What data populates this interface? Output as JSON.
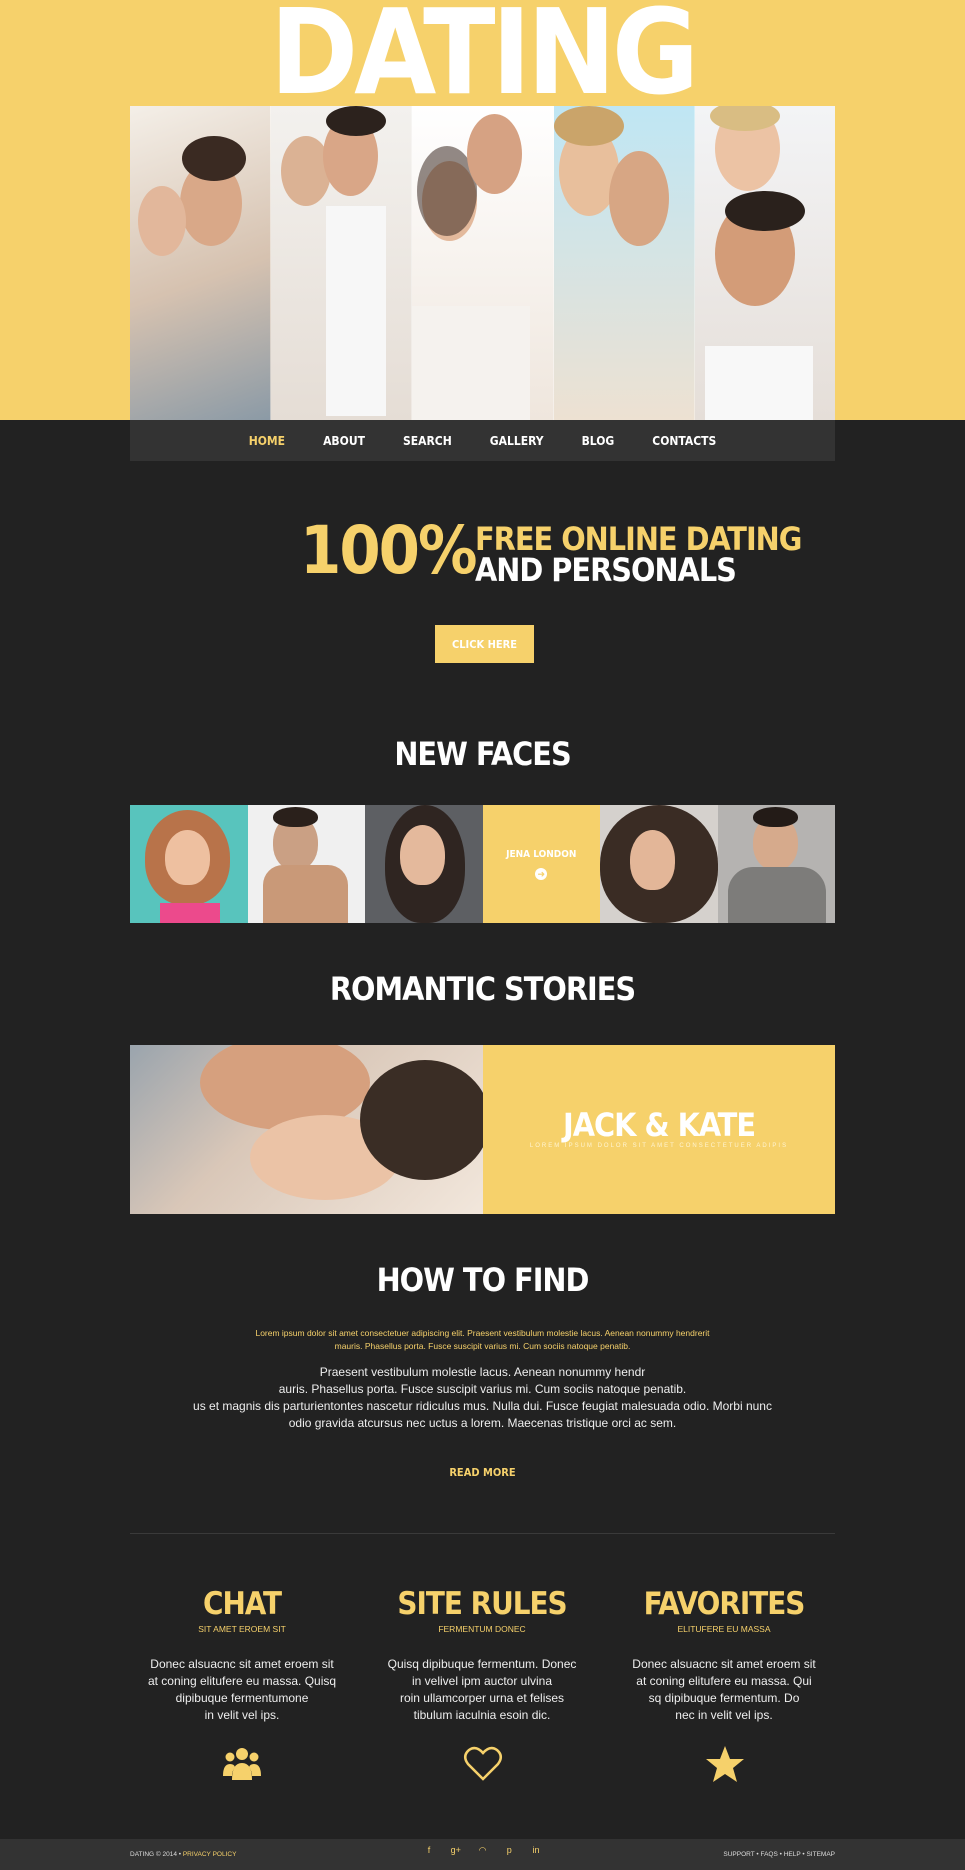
{
  "header": {
    "logo": "DATING"
  },
  "nav": {
    "items": [
      "HOME",
      "ABOUT",
      "SEARCH",
      "GALLERY",
      "BLOG",
      "CONTACTS"
    ],
    "active": "HOME"
  },
  "promo": {
    "percent": "100%",
    "line1": "FREE ONLINE DATING",
    "line2": "AND PERSONALS",
    "cta": "CLICK HERE"
  },
  "new_faces": {
    "title": "NEW FACES",
    "featured_name": "JENA LONDON"
  },
  "stories": {
    "title": "ROMANTIC STORIES",
    "couple": "JACK & KATE",
    "subtitle": "LOREM IPSUM DOLOR SIT AMET CONSECTETUER ADIPIS"
  },
  "how_to_find": {
    "title": "HOW TO FIND",
    "lead": "Lorem ipsum dolor sit amet consectetuer adipiscing elit. Praesent vestibulum molestie lacus. Aenean nonummy hendrerit mauris. Phasellus porta. Fusce suscipit varius mi. Cum sociis natoque penatib.",
    "body": [
      "Praesent vestibulum molestie lacus. Aenean nonummy hendr",
      "auris. Phasellus porta. Fusce suscipit varius mi. Cum sociis natoque penatib.",
      "us et magnis dis parturientontes nascetur ridiculus mus. Nulla dui. Fusce feugiat malesuada odio. Morbi nunc",
      "odio gravida atcursus nec uctus a lorem. Maecenas tristique orci ac sem."
    ],
    "read_more": "READ MORE"
  },
  "columns": [
    {
      "title": "CHAT",
      "subtitle": "SIT AMET EROEM SIT",
      "body": [
        "Donec alsuacnc sit amet eroem sit",
        "at coning elitufere eu massa. Quisq",
        "dipibuque fermentumone",
        "in velit vel ips."
      ],
      "icon": "group-icon"
    },
    {
      "title": "SITE RULES",
      "subtitle": "FERMENTUM DONEC",
      "body": [
        "Quisq dipibuque fermentum. Donec",
        "in velivel ipm auctor ulvina",
        "roin ullamcorper urna et felises",
        "tibulum iaculnia esoin dic."
      ],
      "icon": "heart-icon"
    },
    {
      "title": "FAVORITES",
      "subtitle": "ELITUFERE EU MASSA",
      "body": [
        "Donec alsuacnc sit amet eroem sit",
        "at coning elitufere eu massa. Qui",
        "sq dipibuque fermentum. Do",
        "nec in velit vel ips."
      ],
      "icon": "star-icon"
    }
  ],
  "footer": {
    "copyright": "DATING © 2014 •",
    "privacy": "PRIVACY POLICY",
    "social": [
      "f",
      "g+",
      "rss",
      "p",
      "in"
    ],
    "links": "SUPPORT • FAQS • HELP • SITEMAP"
  },
  "colors": {
    "accent": "#f6d16b",
    "background": "#222222",
    "nav": "#333333"
  }
}
